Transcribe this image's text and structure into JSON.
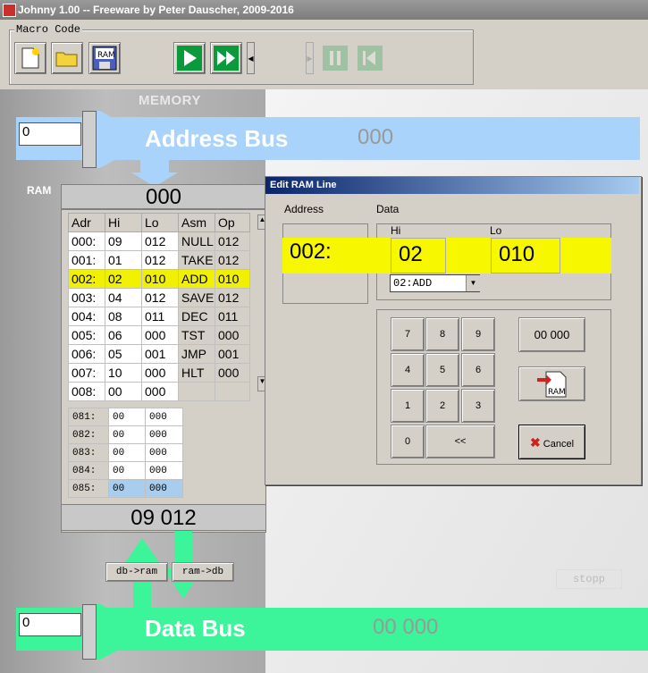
{
  "window": {
    "title": "Johnny 1.00 --  Freeware by Peter Dauscher, 2009-2016"
  },
  "toolbar": {
    "group_label": "Macro Code",
    "ram_button_label": "RAM",
    "buttons": [
      "new-file-icon",
      "open-folder-icon",
      "ram-save-icon",
      "play-icon",
      "fast-forward-icon",
      "step-left-icon",
      "step-right-icon",
      "pause-icon",
      "reset-icon"
    ]
  },
  "memory": {
    "title": "MEMORY",
    "ram_label": "RAM",
    "address_display": "000",
    "data_display": "09  012",
    "columns": [
      "Adr",
      "Hi",
      "Lo",
      "Asm",
      "Op"
    ],
    "rows": [
      {
        "adr": "000:",
        "hi": "09",
        "lo": "012",
        "asm": "NULL",
        "op": "012"
      },
      {
        "adr": "001:",
        "hi": "01",
        "lo": "012",
        "asm": "TAKE",
        "op": "012"
      },
      {
        "adr": "002:",
        "hi": "02",
        "lo": "010",
        "asm": "ADD",
        "op": "010"
      },
      {
        "adr": "003:",
        "hi": "04",
        "lo": "012",
        "asm": "SAVE",
        "op": "012"
      },
      {
        "adr": "004:",
        "hi": "08",
        "lo": "011",
        "asm": "DEC",
        "op": "011"
      },
      {
        "adr": "005:",
        "hi": "06",
        "lo": "000",
        "asm": "TST",
        "op": "000"
      },
      {
        "adr": "006:",
        "hi": "05",
        "lo": "001",
        "asm": "JMP",
        "op": "001"
      },
      {
        "adr": "007:",
        "hi": "10",
        "lo": "000",
        "asm": "HLT",
        "op": "000"
      },
      {
        "adr": "008:",
        "hi": "00",
        "lo": "000",
        "asm": "",
        "op": ""
      }
    ],
    "lower_rows": [
      {
        "adr": "081:",
        "hi": "00",
        "lo": "000"
      },
      {
        "adr": "082:",
        "hi": "00",
        "lo": "000"
      },
      {
        "adr": "083:",
        "hi": "00",
        "lo": "000"
      },
      {
        "adr": "084:",
        "hi": "00",
        "lo": "000"
      },
      {
        "adr": "085:",
        "hi": "00",
        "lo": "000"
      }
    ],
    "btn_db_ram": "db->ram",
    "btn_ram_db": "ram->db"
  },
  "address_bus": {
    "label": "Address Bus",
    "input_value": "0",
    "value": "000"
  },
  "data_bus": {
    "label": "Data Bus",
    "input_value": "0",
    "value": "00 000"
  },
  "control": {
    "stopp": "stopp"
  },
  "dialog": {
    "title": "Edit RAM Line",
    "address_label": "Address",
    "data_label": "Data",
    "hi_label": "Hi",
    "lo_label": "Lo",
    "address_value": "002:",
    "hi_value": "02",
    "lo_value": "010",
    "opcode_select": "02:ADD",
    "keys": [
      "7",
      "8",
      "9",
      "4",
      "5",
      "6",
      "1",
      "2",
      "3",
      "0",
      "<<"
    ],
    "zero_button": "00 000",
    "ram_icon_label": "RAM",
    "cancel_button": "Cancel"
  },
  "colors": {
    "address_bus": "#a9d3fb",
    "data_bus": "#3cf59a",
    "highlight": "#f7f700",
    "dialog_title": "#0a246a"
  }
}
